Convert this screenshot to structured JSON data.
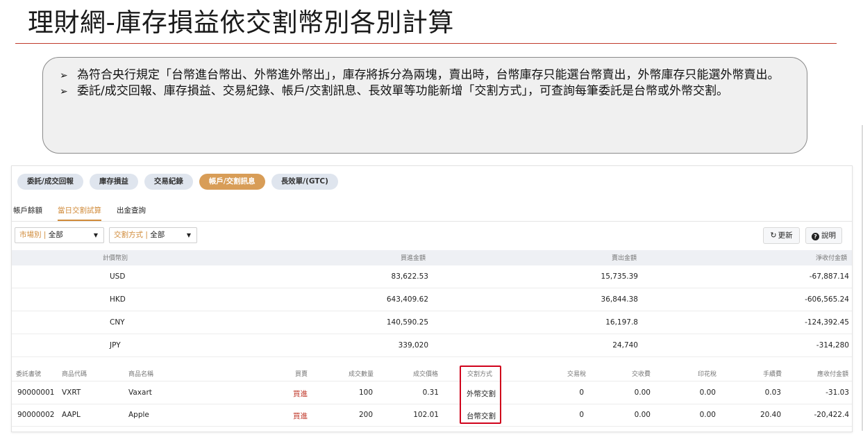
{
  "title": "理財網-庫存損益依交割幣別各別計算",
  "notes": [
    {
      "text": "為符合央行規定「台幣進台幣出、外幣進外幣出」，庫存將拆分為兩塊，賣出時，台幣庫存只能選台幣賣出，外幣庫存只能選外幣賣出。"
    },
    {
      "text": "委託/成交回報、庫存損益、交易紀錄、帳戶/交割訊息、長效單等功能新增「交割方式」，可查詢每筆委託是台幣或外幣交割。"
    }
  ],
  "bullet_glyph": "➢",
  "pills": [
    "委託/成交回報",
    "庫存損益",
    "交易紀錄",
    "帳戶/交割訊息",
    "長效單/(GTC)"
  ],
  "subtabs": [
    "帳戶餘額",
    "當日交割試算",
    "出金查詢"
  ],
  "filters": {
    "market_label": "市場別 |",
    "market_value": "全部",
    "settle_label": "交割方式 |",
    "settle_value": "全部",
    "caret": "▼"
  },
  "buttons": {
    "refresh": "更新",
    "refresh_icon": "↻",
    "help": "說明",
    "help_icon": "?"
  },
  "summary": {
    "headers": [
      "計價幣別",
      "買進金額",
      "賣出金額",
      "淨收付金額"
    ],
    "rows": [
      {
        "currency": "USD",
        "buy": "83,622.53",
        "sell": "15,735.39",
        "net": "-67,887.14"
      },
      {
        "currency": "HKD",
        "buy": "643,409.62",
        "sell": "36,844.38",
        "net": "-606,565.24"
      },
      {
        "currency": "CNY",
        "buy": "140,590.25",
        "sell": "16,197.8",
        "net": "-124,392.45"
      },
      {
        "currency": "JPY",
        "buy": "339,020",
        "sell": "24,740",
        "net": "-314,280"
      }
    ]
  },
  "details": {
    "headers": [
      "委託書號",
      "商品代碼",
      "商品名稱",
      "買賣",
      "成交數量",
      "成交價格",
      "交割方式",
      "交易稅",
      "交收費",
      "印花稅",
      "手續費",
      "應收付金額"
    ],
    "rows": [
      {
        "order": "90000001",
        "code": "VXRT",
        "name": "Vaxart",
        "side": "買進",
        "qty": "100",
        "price": "0.31",
        "settle": "外幣交割",
        "tax": "0",
        "clearing": "0.00",
        "stamp": "0.00",
        "fee": "0.03",
        "amount": "-31.03"
      },
      {
        "order": "90000002",
        "code": "AAPL",
        "name": "Apple",
        "side": "買進",
        "qty": "200",
        "price": "102.01",
        "settle": "台幣交割",
        "tax": "0",
        "clearing": "0.00",
        "stamp": "0.00",
        "fee": "20.40",
        "amount": "-20,422.4"
      }
    ]
  },
  "colors": {
    "accent": "#d89d57",
    "title_rule": "#c0392b",
    "highlight": "#d0021b",
    "buy": "#c0392b"
  }
}
